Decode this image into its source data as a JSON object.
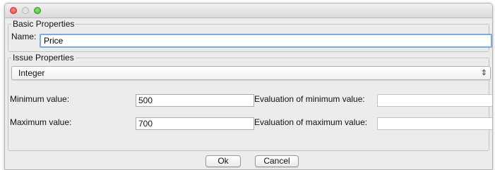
{
  "window": {
    "controls": [
      "close-icon",
      "minimize-icon",
      "zoom-icon"
    ],
    "colors": {
      "close": "#e0443e",
      "zoom": "#3fb72b",
      "focus_ring": "#7ea9e3"
    }
  },
  "basic_properties": {
    "title": "Basic Properties",
    "name_label": "Name:",
    "name_value": "Price"
  },
  "issue_properties": {
    "title": "Issue Properties",
    "type_selected": "Integer",
    "select_arrows": "⌃⌄",
    "min_label": "Minimum value:",
    "min_value": "500",
    "eval_min_label": "Evaluation of minimum value:",
    "eval_min_value": "",
    "max_label": "Maximum value:",
    "max_value": "700",
    "eval_max_label": "Evaluation of maximum value:",
    "eval_max_value": ""
  },
  "buttons": {
    "ok": "Ok",
    "cancel": "Cancel"
  }
}
